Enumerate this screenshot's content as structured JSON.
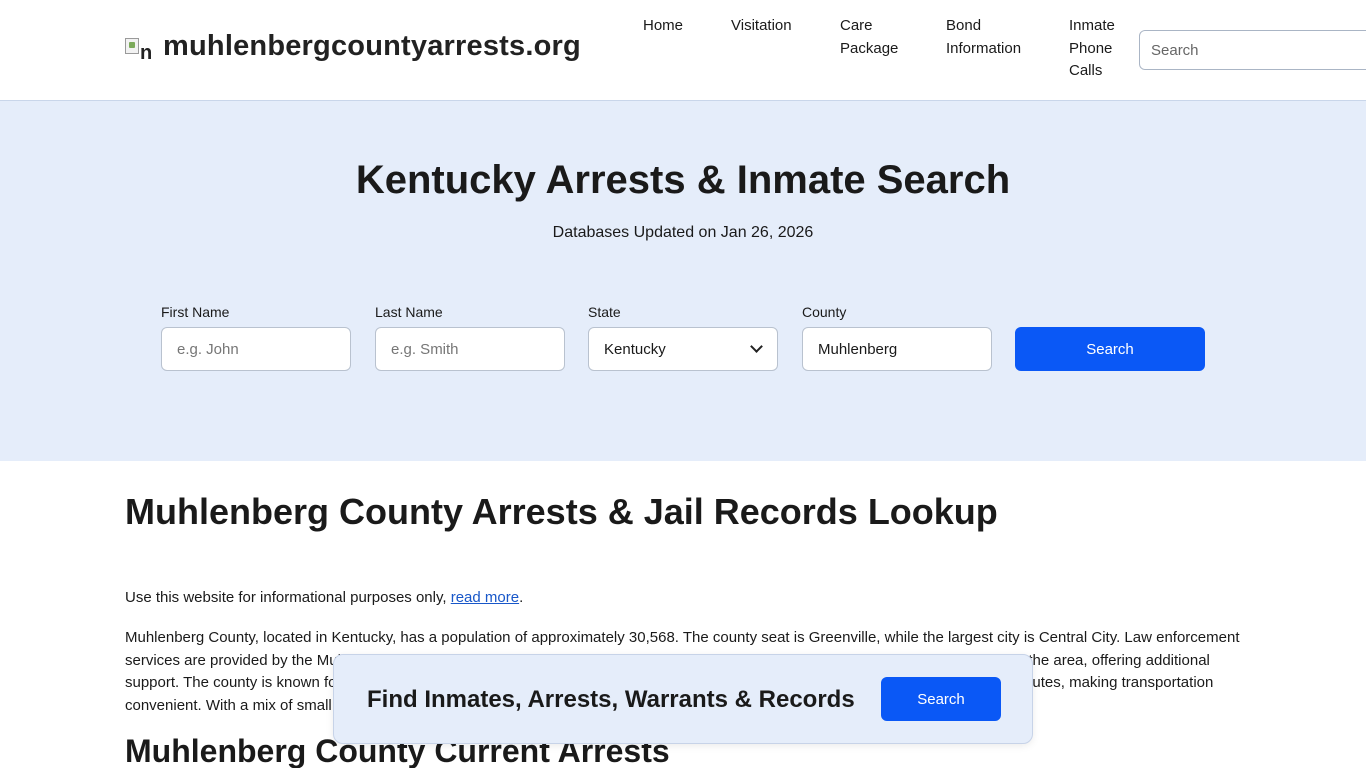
{
  "header": {
    "logo_alt": "n",
    "site_name": "muhlenbergcountyarrests.org",
    "nav": {
      "home": "Home",
      "visitation": "Visitation",
      "care_package": "Care\nPackage",
      "bond_information": "Bond\nInformation",
      "inmate_phone_calls": "Inmate\nPhone\nCalls"
    },
    "search_placeholder": "Search"
  },
  "hero": {
    "title": "Kentucky Arrests & Inmate Search",
    "updated": "Databases Updated on Jan 26, 2026",
    "form": {
      "first_name_label": "First Name",
      "first_name_placeholder": "e.g. John",
      "last_name_label": "Last Name",
      "last_name_placeholder": "e.g. Smith",
      "state_label": "State",
      "state_value": "Kentucky",
      "county_label": "County",
      "county_value": "Muhlenberg",
      "search_label": "Search"
    }
  },
  "content": {
    "title": "Muhlenberg County Arrests & Jail Records Lookup",
    "disclaimer_text": "Use this website for informational purposes only, ",
    "disclaimer_link": "read more",
    "disclaimer_end": ".",
    "paragraph_line1": "Muhlenberg County, located in Kentucky, has a population of approximately 30,568. The county seat is Greenville, while the largest city is Central City. Law enforcement",
    "paragraph_line2": "services are provided by the Muhlenberg County Sheriff's Office based in Greenville. The Kentucky State Police also have jurisdiction in the area, offering additional",
    "paragraph_line3": "support. The county is known for its rich coal mining history. Major highways running through the county include several state and U.S. routes, making transportation",
    "paragraph_line4": "convenient. With a mix of small towns and rural communities",
    "section_title": "Muhlenberg County Current Arrests"
  },
  "float_bar": {
    "text": "Find Inmates, Arrests, Warrants & Records",
    "button": "Search"
  },
  "colors": {
    "accent": "#0a58f6",
    "hero_bg": "#e5edfa",
    "link": "#1857c9"
  }
}
